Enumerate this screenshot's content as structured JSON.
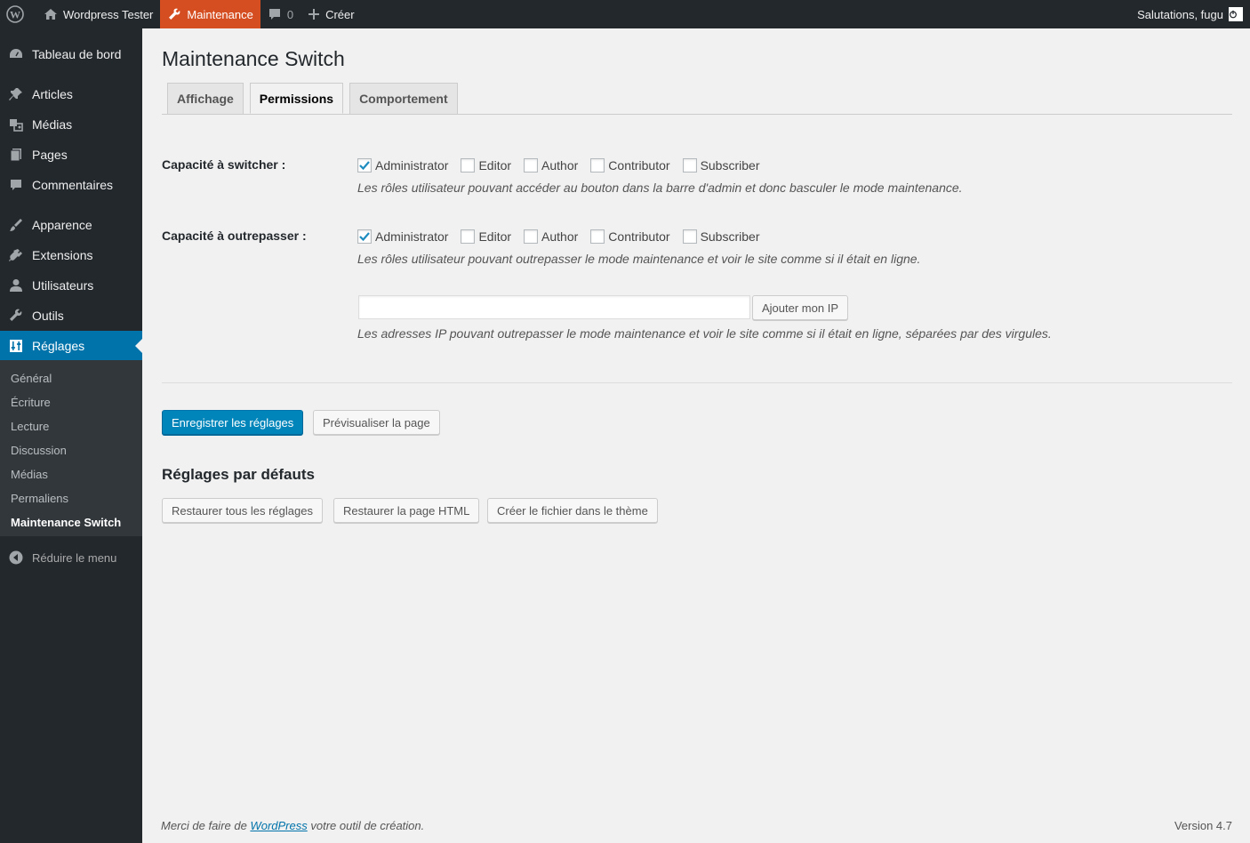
{
  "adminbar": {
    "site_name": "Wordpress Tester",
    "maintenance_label": "Maintenance",
    "comments_count": "0",
    "new_label": "Créer",
    "greeting": "Salutations, fugu"
  },
  "sidebar": {
    "items": [
      {
        "label": "Tableau de bord",
        "icon": "dashboard-icon"
      },
      {
        "label": "Articles",
        "icon": "pin-icon"
      },
      {
        "label": "Médias",
        "icon": "media-icon"
      },
      {
        "label": "Pages",
        "icon": "pages-icon"
      },
      {
        "label": "Commentaires",
        "icon": "comments-icon"
      },
      {
        "label": "Apparence",
        "icon": "appearance-icon"
      },
      {
        "label": "Extensions",
        "icon": "plugins-icon"
      },
      {
        "label": "Utilisateurs",
        "icon": "users-icon"
      },
      {
        "label": "Outils",
        "icon": "tools-icon"
      },
      {
        "label": "Réglages",
        "icon": "settings-icon"
      }
    ],
    "submenu": [
      "Général",
      "Écriture",
      "Lecture",
      "Discussion",
      "Médias",
      "Permaliens",
      "Maintenance Switch"
    ],
    "collapse_label": "Réduire le menu"
  },
  "main": {
    "title": "Maintenance Switch",
    "tabs": [
      "Affichage",
      "Permissions",
      "Comportement"
    ],
    "active_tab": "Permissions",
    "switch_row": {
      "label": "Capacité à switcher :",
      "roles": [
        {
          "name": "Administrator",
          "checked": true
        },
        {
          "name": "Editor",
          "checked": false
        },
        {
          "name": "Author",
          "checked": false
        },
        {
          "name": "Contributor",
          "checked": false
        },
        {
          "name": "Subscriber",
          "checked": false
        }
      ],
      "description": "Les rôles utilisateur pouvant accéder au bouton dans la barre d'admin et donc basculer le mode maintenance."
    },
    "bypass_row": {
      "label": "Capacité à outrepasser :",
      "roles": [
        {
          "name": "Administrator",
          "checked": true
        },
        {
          "name": "Editor",
          "checked": false
        },
        {
          "name": "Author",
          "checked": false
        },
        {
          "name": "Contributor",
          "checked": false
        },
        {
          "name": "Subscriber",
          "checked": false
        }
      ],
      "description": "Les rôles utilisateur pouvant outrepasser le mode maintenance et voir le site comme si il était en ligne."
    },
    "ip": {
      "value": "",
      "add_button": "Ajouter mon IP",
      "description": "Les adresses IP pouvant outrepasser le mode maintenance et voir le site comme si il était en ligne, séparées par des virgules."
    },
    "save_button": "Enregistrer les réglages",
    "preview_button": "Prévisualiser la page",
    "defaults_title": "Réglages par défauts",
    "restore_all_button": "Restaurer tous les réglages",
    "restore_html_button": "Restaurer la page HTML",
    "create_file_button": "Créer le fichier dans le thème"
  },
  "footer": {
    "thanks_prefix": "Merci de faire de ",
    "thanks_link": "WordPress",
    "thanks_suffix": " votre outil de création.",
    "version": "Version 4.7"
  },
  "colors": {
    "accent": "#0073aa",
    "primary_button": "#0085ba",
    "maintenance_bar": "#d54e21",
    "sidebar_bg": "#23282d"
  }
}
